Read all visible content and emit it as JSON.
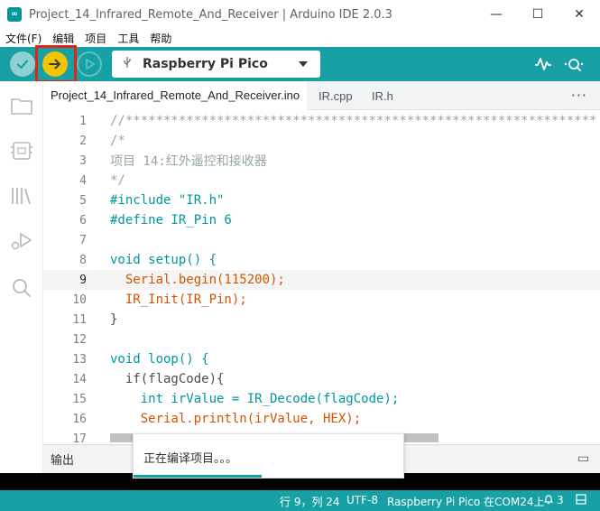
{
  "window": {
    "title": "Project_14_Infrared_Remote_And_Receiver | Arduino IDE 2.0.3",
    "minimize": "—",
    "maximize": "☐",
    "close": "✕"
  },
  "menu": [
    "文件(F)",
    "编辑",
    "项目",
    "工具",
    "帮助"
  ],
  "toolbar": {
    "board": "Raspberry Pi Pico",
    "icons": [
      "verify-icon",
      "upload-icon",
      "debug-icon",
      "serial-plotter-icon",
      "serial-monitor-icon"
    ],
    "highlight_color": "#e2231a",
    "accent": "#17a1a5"
  },
  "tabs": [
    {
      "label": "Project_14_Infrared_Remote_And_Receiver.ino"
    },
    {
      "label": "IR.cpp"
    },
    {
      "label": "IR.h"
    }
  ],
  "editor": {
    "line_numbers": [
      "1",
      "2",
      "3",
      "4",
      "5",
      "6",
      "7",
      "8",
      "9",
      "10",
      "11",
      "12",
      "13",
      "14",
      "15",
      "16",
      "17"
    ],
    "current_line": 9,
    "lines": [
      "//**************************************************************",
      "/*",
      "项目 14:红外遥控和接收器",
      "*/",
      "#include \"IR.h\"",
      "#define IR_Pin 6",
      "",
      "void setup() {",
      "  Serial.begin(115200);",
      "  IR_Init(IR_Pin);",
      "}",
      "",
      "void loop() {",
      "  if(flagCode){",
      "    int irValue = IR_Decode(flagCode);",
      "    Serial.println(irValue, HEX);",
      ""
    ]
  },
  "output": {
    "label": "输出"
  },
  "toast": {
    "message": "正在编译项目。。。"
  },
  "status": {
    "position": "行 9，列 24",
    "encoding": "UTF-8",
    "board_port": "Raspberry Pi Pico 在COM24上",
    "notifications": "3"
  }
}
